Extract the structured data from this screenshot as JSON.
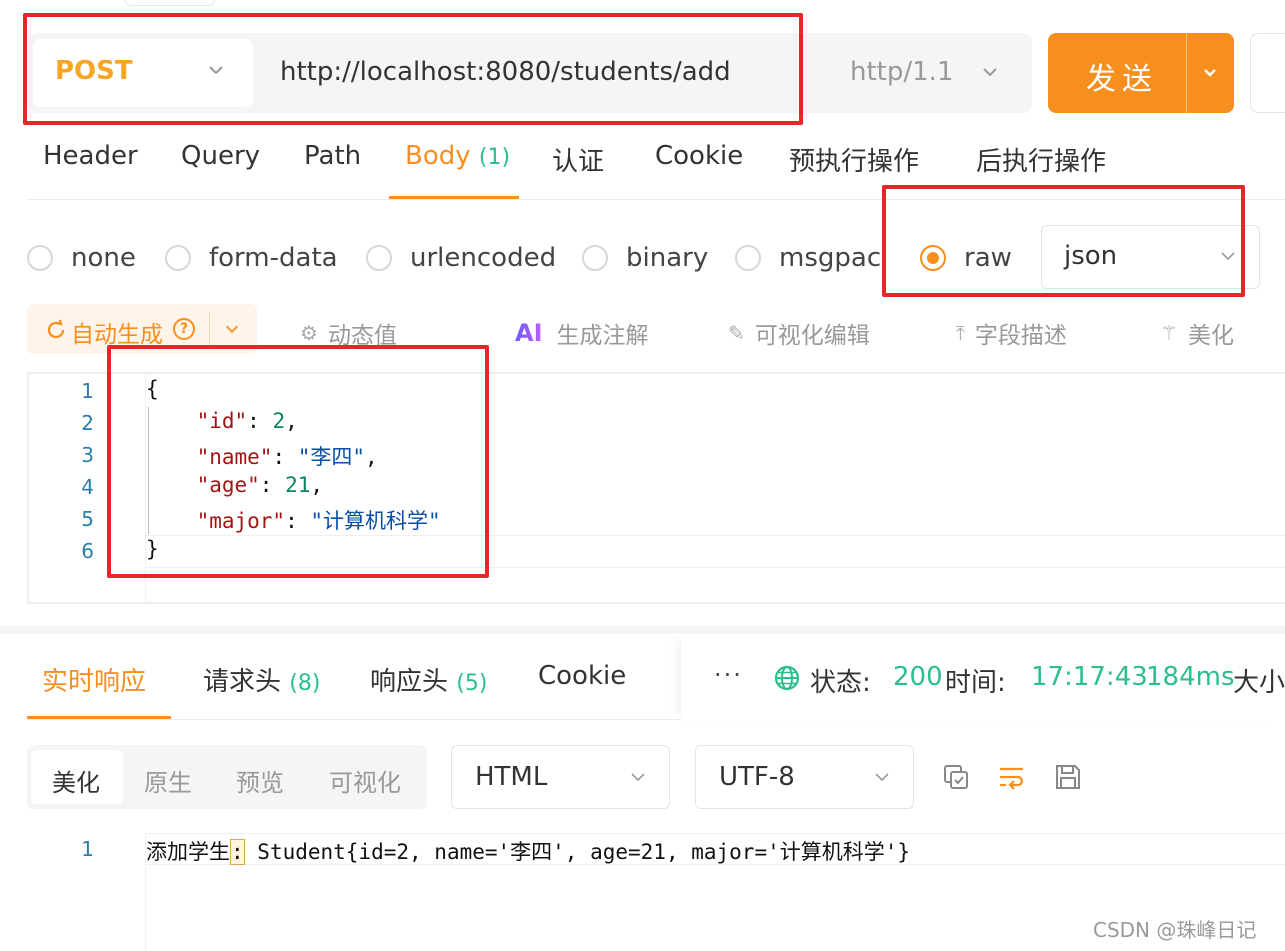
{
  "request": {
    "method": "POST",
    "url": "http://localhost:8080/students/add",
    "protocol": "http/1.1",
    "send_label": "发送"
  },
  "request_tabs": [
    {
      "label": "Header",
      "count": ""
    },
    {
      "label": "Query",
      "count": ""
    },
    {
      "label": "Path",
      "count": ""
    },
    {
      "label": "Body",
      "count": "(1)"
    },
    {
      "label": "认证",
      "count": ""
    },
    {
      "label": "Cookie",
      "count": ""
    },
    {
      "label": "预执行操作",
      "count": ""
    },
    {
      "label": "后执行操作",
      "count": ""
    }
  ],
  "active_request_tab": "Body",
  "body_types": [
    "none",
    "form-data",
    "urlencoded",
    "binary",
    "msgpack",
    "raw"
  ],
  "selected_body_type": "raw",
  "raw_format": "json",
  "toolbar": {
    "auto_generate": "自动生成",
    "dynamic_value": "动态值",
    "ai_label": "AI",
    "generate_comments": "生成注解",
    "visual_edit": "可视化编辑",
    "field_desc": "字段描述",
    "beautify": "美化"
  },
  "editor": {
    "line_numbers": [
      "1",
      "2",
      "3",
      "4",
      "5",
      "6"
    ],
    "lines": {
      "l1": "{",
      "l2_key": "\"id\"",
      "l2_val": "2",
      "l3_key": "\"name\"",
      "l3_val": "\"李四\"",
      "l4_key": "\"age\"",
      "l4_val": "21",
      "l5_key": "\"major\"",
      "l5_val": "\"计算机科学\"",
      "l6": "}"
    }
  },
  "response_tabs": [
    {
      "label": "实时响应",
      "count": ""
    },
    {
      "label": "请求头",
      "count": "(8)"
    },
    {
      "label": "响应头",
      "count": "(5)"
    },
    {
      "label": "Cookie",
      "count": ""
    }
  ],
  "status": {
    "more": "···",
    "status_label": "状态:",
    "status_code": "200",
    "time_label": "时间:",
    "time_value": "17:17:43",
    "duration": "184ms",
    "size_label": "大小"
  },
  "view_modes": [
    "美化",
    "原生",
    "预览",
    "可视化"
  ],
  "active_view_mode": "美化",
  "response_format": "HTML",
  "encoding": "UTF-8",
  "response": {
    "line_number": "1",
    "prefix": "添加学生",
    "colon": ":",
    "body": " Student{id=2, name='李四', age=21, major='计算机科学'}"
  },
  "watermark": "CSDN @珠峰日记",
  "colors": {
    "accent": "#f78f1e",
    "method": "#f5a623",
    "success": "#2bbf8a",
    "annotation": "#e8262a"
  }
}
